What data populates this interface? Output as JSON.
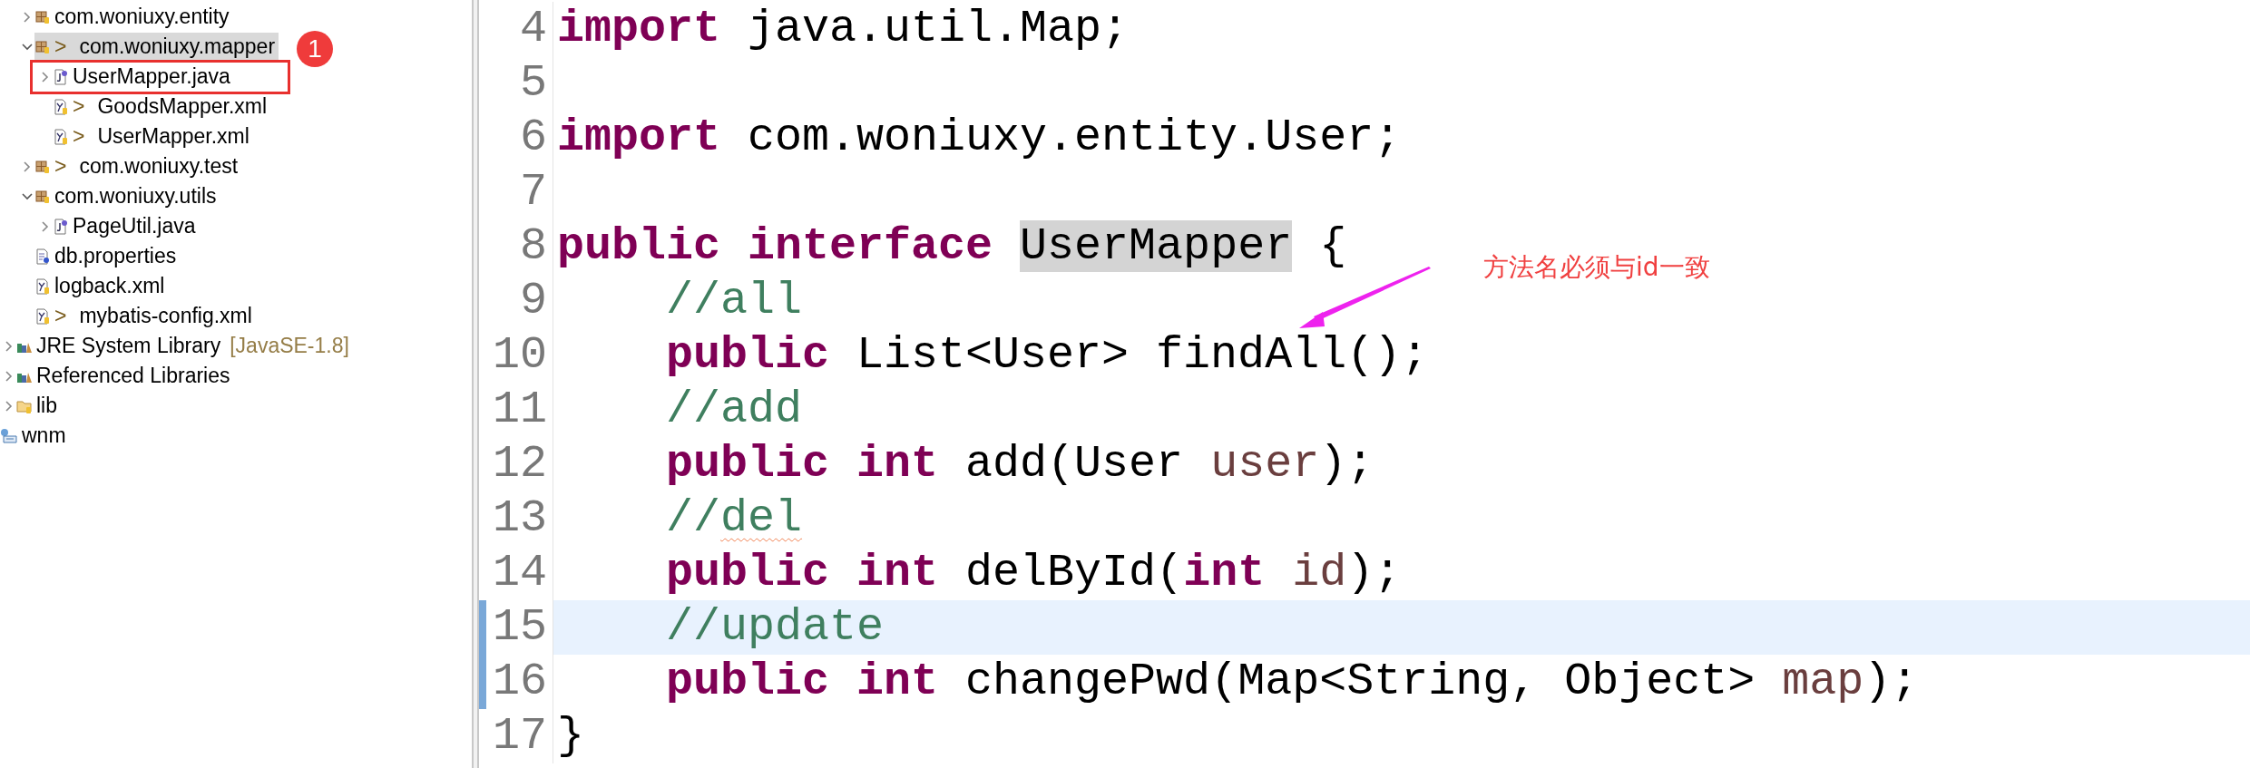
{
  "explorer": {
    "source_items": [
      {
        "label": "com.woniuxy.entity",
        "kind": "package",
        "expanded": false,
        "selected": false
      },
      {
        "label": "com.woniuxy.mapper",
        "marker": ">",
        "kind": "package",
        "expanded": true,
        "selected": true,
        "children": [
          {
            "label": "UserMapper.java",
            "kind": "java",
            "expanded": false,
            "selected": false,
            "annotated": true
          },
          {
            "label": "GoodsMapper.xml",
            "marker": ">",
            "kind": "xml",
            "selected": false
          },
          {
            "label": "UserMapper.xml",
            "marker": ">",
            "kind": "xml",
            "selected": false
          }
        ]
      },
      {
        "label": "com.woniuxy.test",
        "marker": ">",
        "kind": "package",
        "expanded": false,
        "selected": false
      },
      {
        "label": "com.woniuxy.utils",
        "kind": "package",
        "expanded": true,
        "selected": false,
        "children": [
          {
            "label": "PageUtil.java",
            "kind": "java",
            "expanded": false,
            "selected": false
          }
        ]
      },
      {
        "label": "db.properties",
        "kind": "properties",
        "selected": false
      },
      {
        "label": "logback.xml",
        "kind": "xml",
        "selected": false
      },
      {
        "label": "mybatis-config.xml",
        "marker": ">",
        "kind": "xml",
        "selected": false
      }
    ],
    "libraries": [
      {
        "label": "JRE System Library",
        "suffix": "[JavaSE-1.8]",
        "kind": "library",
        "expanded": false,
        "selected": false
      },
      {
        "label": "Referenced Libraries",
        "kind": "library",
        "expanded": false,
        "selected": false
      },
      {
        "label": "lib",
        "kind": "folder",
        "expanded": false,
        "selected": false
      }
    ],
    "projects": [
      {
        "label": "wnm",
        "kind": "project",
        "selected": false
      }
    ]
  },
  "editor": {
    "lines": [
      {
        "number": "4",
        "current": false,
        "changed": false,
        "indented": false,
        "tokens": [
          {
            "text": "import",
            "kind": "keyword"
          },
          {
            "text": " java.util.Map;",
            "kind": "plain"
          }
        ]
      },
      {
        "number": "5",
        "current": false,
        "changed": false
      },
      {
        "number": "6",
        "current": false,
        "changed": false,
        "indented": false,
        "tokens": [
          {
            "text": "import",
            "kind": "keyword"
          },
          {
            "text": " com.woniuxy.entity.User;",
            "kind": "plain"
          }
        ]
      },
      {
        "number": "7",
        "current": false,
        "changed": false
      },
      {
        "number": "8",
        "current": false,
        "changed": false,
        "indented": false,
        "tokens": [
          {
            "text": "public interface ",
            "kind": "keyword"
          },
          {
            "text": "UserMapper",
            "kind": "occurrence"
          },
          {
            "text": " {",
            "kind": "plain"
          }
        ]
      },
      {
        "number": "9",
        "current": false,
        "changed": false,
        "indented": true,
        "tokens": [
          {
            "text": "//all",
            "kind": "comment"
          }
        ]
      },
      {
        "number": "10",
        "current": false,
        "changed": false,
        "indented": true,
        "tokens": [
          {
            "text": "public",
            "kind": "keyword"
          },
          {
            "text": " List<User> findAll();",
            "kind": "plain"
          }
        ]
      },
      {
        "number": "11",
        "current": false,
        "changed": false,
        "indented": true,
        "tokens": [
          {
            "text": "//add",
            "kind": "comment"
          }
        ]
      },
      {
        "number": "12",
        "current": false,
        "changed": false,
        "indented": true,
        "tokens": [
          {
            "text": "public int",
            "kind": "keyword"
          },
          {
            "text": " add(User ",
            "kind": "plain"
          },
          {
            "text": "user",
            "kind": "param"
          },
          {
            "text": ");",
            "kind": "plain"
          }
        ]
      },
      {
        "number": "13",
        "current": false,
        "changed": false,
        "indented": true,
        "tokens": [
          {
            "text": "//",
            "kind": "comment"
          },
          {
            "text": "del",
            "kind": "misspelled"
          }
        ]
      },
      {
        "number": "14",
        "current": false,
        "changed": false,
        "indented": true,
        "tokens": [
          {
            "text": "public int",
            "kind": "keyword"
          },
          {
            "text": " delById(",
            "kind": "plain"
          },
          {
            "text": "int",
            "kind": "keyword"
          },
          {
            "text": " id",
            "kind": "param"
          },
          {
            "text": ");",
            "kind": "plain"
          }
        ]
      },
      {
        "number": "15",
        "current": true,
        "changed": true,
        "indented": true,
        "tokens": [
          {
            "text": "//update",
            "kind": "comment"
          }
        ]
      },
      {
        "number": "16",
        "current": false,
        "changed": true,
        "indented": true,
        "tokens": [
          {
            "text": "public int",
            "kind": "keyword"
          },
          {
            "text": " changePwd(Map<String, Object> ",
            "kind": "plain"
          },
          {
            "text": "map",
            "kind": "param"
          },
          {
            "text": ");",
            "kind": "plain"
          }
        ]
      },
      {
        "number": "17",
        "current": false,
        "changed": false,
        "indented": false,
        "tokens": [
          {
            "text": "}",
            "kind": "plain"
          }
        ]
      }
    ]
  },
  "annotations": {
    "badge": "1",
    "note": "方法名必须与id一致"
  }
}
